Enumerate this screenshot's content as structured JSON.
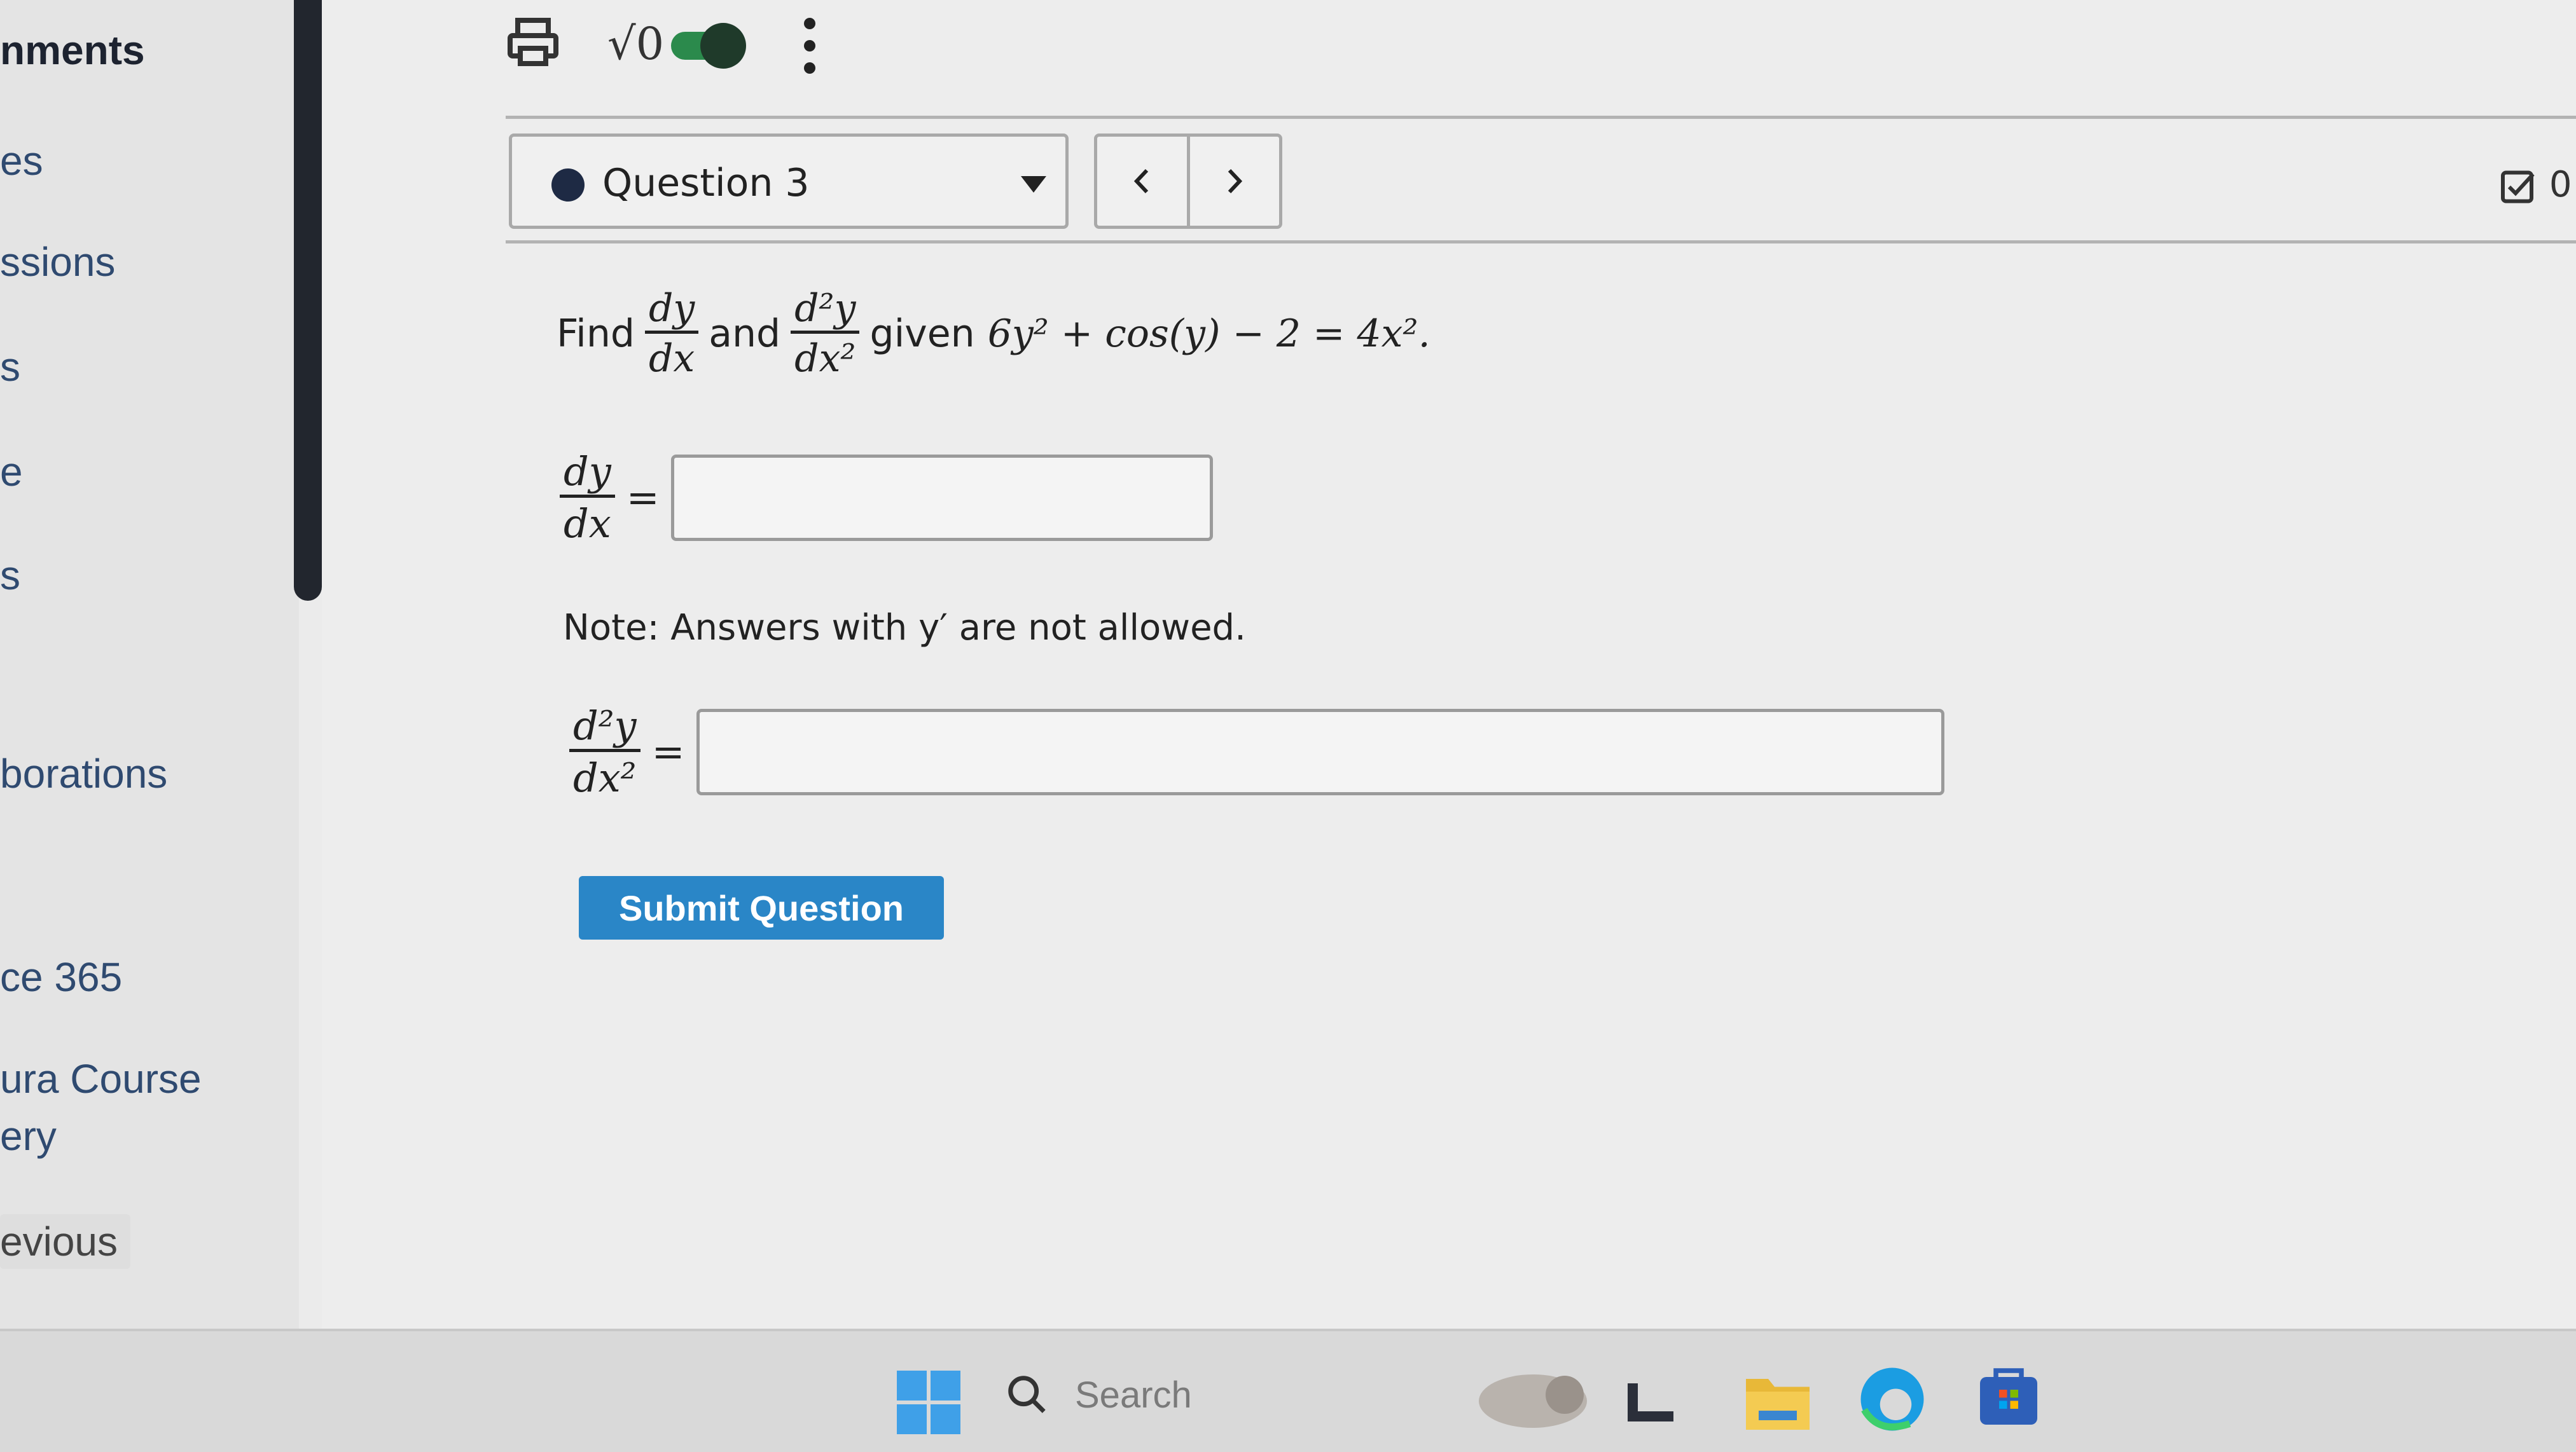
{
  "sidebar": {
    "items": [
      {
        "label": "nments"
      },
      {
        "label": "es"
      },
      {
        "label": "ssions"
      },
      {
        "label": "s"
      },
      {
        "label": "e"
      },
      {
        "label": "s"
      },
      {
        "label": "borations"
      },
      {
        "label": "ce 365"
      },
      {
        "label": "ura Course"
      },
      {
        "label": "ery"
      },
      {
        "label": "evious"
      }
    ]
  },
  "toolbar": {
    "icons": [
      "print-icon",
      "math-toggle-icon",
      "more-options-icon"
    ],
    "math_label": "√0"
  },
  "question": {
    "selector_label": "Question 3",
    "counter": "0",
    "prompt_find": "Find",
    "prompt_and": "and",
    "prompt_given": "given",
    "equation": "6y² + cos(y) − 2 = 4x².",
    "frac1_num": "dy",
    "frac1_den": "dx",
    "frac2_num": "d²y",
    "frac2_den": "dx²",
    "answer1_value": "",
    "answer2_value": "",
    "note": "Note: Answers with y′ are not allowed.",
    "submit_label": "Submit Question"
  },
  "taskbar": {
    "search_placeholder": "Search",
    "icons": [
      "windows-start-icon",
      "search-icon",
      "task-view-icon",
      "file-explorer-icon",
      "edge-browser-icon",
      "store-icon"
    ]
  },
  "colors": {
    "accent": "#2a86c7",
    "toggle": "#1f6b3a"
  }
}
